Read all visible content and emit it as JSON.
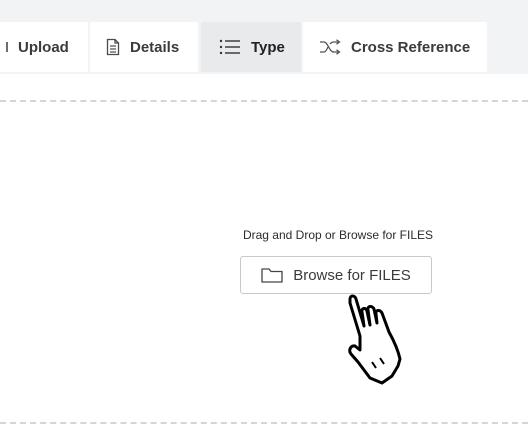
{
  "tabs": [
    {
      "label": "Upload",
      "icon": "none"
    },
    {
      "label": "Details",
      "icon": "document-icon"
    },
    {
      "label": "Type",
      "icon": "list-icon"
    },
    {
      "label": "Cross Reference",
      "icon": "shuffle-icon"
    }
  ],
  "dropzone": {
    "instruction": "Drag and Drop or Browse for FILES",
    "browse_label": "Browse for FILES",
    "browse_icon": "folder-icon"
  },
  "cursor": {
    "icon": "hand-pointer-icon"
  }
}
